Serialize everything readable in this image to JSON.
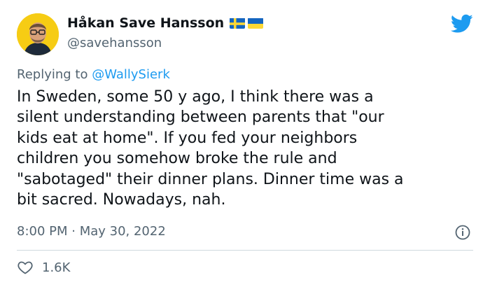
{
  "author": {
    "display_name": "Håkan Save Hansson",
    "handle": "@savehansson",
    "flags": [
      "sweden-flag-icon",
      "ukraine-flag-icon"
    ]
  },
  "reply": {
    "prefix": "Replying to",
    "mention": "@WallySierk"
  },
  "tweet": {
    "lines": [
      "In Sweden, some 50 y ago, I think there was a",
      "silent understanding between parents that \"our",
      "kids eat at home\". If you fed your neighbors",
      "children you somehow broke the rule and",
      "\"sabotaged\" their dinner plans. Dinner time was a",
      "bit sacred. Nowadays, nah."
    ],
    "timestamp": "8:00 PM · May 30, 2022",
    "like_count": "1.6K"
  },
  "icons": {
    "brand": "twitter-bird-icon",
    "info": "info-icon",
    "like": "heart-icon"
  },
  "colors": {
    "text_primary": "#0f1419",
    "text_secondary": "#536471",
    "link": "#1d9bf0",
    "divider": "#cfd9de",
    "avatar_bg": "#f6cc14"
  }
}
